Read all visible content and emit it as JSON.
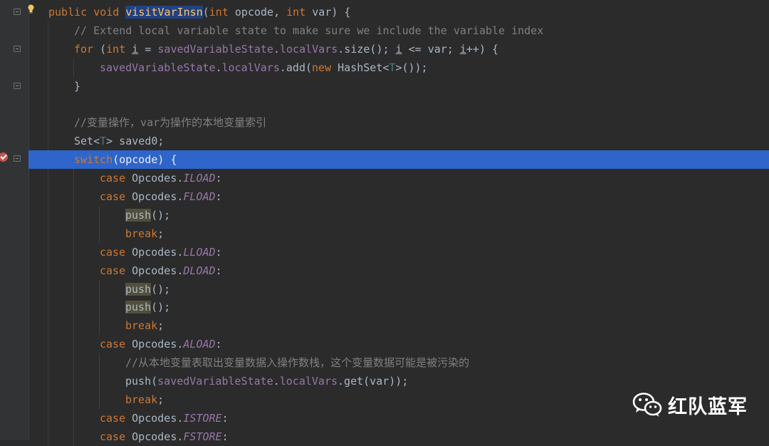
{
  "editor": {
    "lines": [
      {
        "id": "l1",
        "tokens": [
          [
            "kw",
            "public void "
          ],
          [
            "fn hlsel",
            "visitVarInsn"
          ],
          [
            "",
            "("
          ],
          [
            "kw",
            "int "
          ],
          [
            "par",
            "opcode"
          ],
          [
            "",
            ", "
          ],
          [
            "kw",
            "int "
          ],
          [
            "par",
            "var"
          ],
          [
            "",
            ") {"
          ]
        ]
      },
      {
        "id": "l2",
        "tokens": [
          [
            "cm",
            "// Extend local variable state to make sure we include the variable index"
          ]
        ]
      },
      {
        "id": "l3",
        "tokens": [
          [
            "kw",
            "for "
          ],
          [
            "",
            "("
          ],
          [
            "kw",
            "int "
          ],
          [
            "u",
            "i"
          ],
          [
            "",
            " = "
          ],
          [
            "fld",
            "savedVariableState"
          ],
          [
            "",
            "."
          ],
          [
            "fld",
            "localVars"
          ],
          [
            "",
            ".size(); "
          ],
          [
            "u",
            "i"
          ],
          [
            "",
            " <= "
          ],
          [
            "par",
            "var"
          ],
          [
            "",
            "; "
          ],
          [
            "u",
            "i"
          ],
          [
            "",
            "++) {"
          ]
        ]
      },
      {
        "id": "l4",
        "tokens": [
          [
            "fld",
            "savedVariableState"
          ],
          [
            "",
            "."
          ],
          [
            "fld",
            "localVars"
          ],
          [
            "",
            ".add("
          ],
          [
            "kw",
            "new "
          ],
          [
            "",
            "HashSet<"
          ],
          [
            "tp",
            "T"
          ],
          [
            "",
            ">());"
          ]
        ]
      },
      {
        "id": "l5",
        "tokens": [
          [
            "",
            "}"
          ]
        ]
      },
      {
        "id": "l6",
        "tokens": []
      },
      {
        "id": "l7",
        "tokens": [
          [
            "cm",
            "//变量操作，var为操作的本地变量索引"
          ]
        ]
      },
      {
        "id": "l8",
        "tokens": [
          [
            "",
            "Set<"
          ],
          [
            "tp",
            "T"
          ],
          [
            "",
            "> saved0;"
          ]
        ]
      },
      {
        "id": "l9",
        "tokens": [
          [
            "kw",
            "switch"
          ],
          [
            "",
            "(opcode) {"
          ]
        ]
      },
      {
        "id": "l10",
        "tokens": [
          [
            "kw",
            "case "
          ],
          [
            "",
            "Opcodes."
          ],
          [
            "st",
            "ILOAD"
          ],
          [
            "",
            ":"
          ]
        ]
      },
      {
        "id": "l11",
        "tokens": [
          [
            "kw",
            "case "
          ],
          [
            "",
            "Opcodes."
          ],
          [
            "st",
            "FLOAD"
          ],
          [
            "",
            ":"
          ]
        ]
      },
      {
        "id": "l12",
        "tokens": [
          [
            "hlpush",
            "push"
          ],
          [
            "",
            "();"
          ]
        ]
      },
      {
        "id": "l13",
        "tokens": [
          [
            "kw",
            "break"
          ],
          [
            "",
            ";"
          ]
        ]
      },
      {
        "id": "l14",
        "tokens": [
          [
            "kw",
            "case "
          ],
          [
            "",
            "Opcodes."
          ],
          [
            "st",
            "LLOAD"
          ],
          [
            "",
            ":"
          ]
        ]
      },
      {
        "id": "l15",
        "tokens": [
          [
            "kw",
            "case "
          ],
          [
            "",
            "Opcodes."
          ],
          [
            "st",
            "DLOAD"
          ],
          [
            "",
            ":"
          ]
        ]
      },
      {
        "id": "l16",
        "tokens": [
          [
            "hlpush",
            "push"
          ],
          [
            "",
            "();"
          ]
        ]
      },
      {
        "id": "l17",
        "tokens": [
          [
            "hlpush",
            "push"
          ],
          [
            "",
            "();"
          ]
        ]
      },
      {
        "id": "l18",
        "tokens": [
          [
            "kw",
            "break"
          ],
          [
            "",
            ";"
          ]
        ]
      },
      {
        "id": "l19",
        "tokens": [
          [
            "kw",
            "case "
          ],
          [
            "",
            "Opcodes."
          ],
          [
            "st",
            "ALOAD"
          ],
          [
            "",
            ":"
          ]
        ]
      },
      {
        "id": "l20",
        "tokens": [
          [
            "cm",
            "//从本地变量表取出变量数据入操作数栈，这个变量数据可能是被污染的"
          ]
        ]
      },
      {
        "id": "l21",
        "tokens": [
          [
            "",
            "push("
          ],
          [
            "fld",
            "savedVariableState"
          ],
          [
            "",
            "."
          ],
          [
            "fld",
            "localVars"
          ],
          [
            "",
            ".get(var));"
          ]
        ]
      },
      {
        "id": "l22",
        "tokens": [
          [
            "kw",
            "break"
          ],
          [
            "",
            ";"
          ]
        ]
      },
      {
        "id": "l23",
        "tokens": [
          [
            "kw",
            "case "
          ],
          [
            "",
            "Opcodes."
          ],
          [
            "st",
            "ISTORE"
          ],
          [
            "",
            ":"
          ]
        ]
      },
      {
        "id": "l24",
        "tokens": [
          [
            "kw",
            "case "
          ],
          [
            "",
            "Opcodes."
          ],
          [
            "st",
            "FSTORE"
          ],
          [
            "",
            ":"
          ]
        ]
      }
    ]
  },
  "watermark": {
    "text": "红队蓝军",
    "icon": "wechat-icon"
  },
  "icons": {
    "intention": "lightbulb-icon",
    "breakpoint": "breakpoint-icon",
    "fold": "fold-marker-icon"
  },
  "colors": {
    "keyword": "#cc7832",
    "method": "#ffc66d",
    "field": "#9876aa",
    "comment": "#808080",
    "selection": "#2f65ca"
  }
}
